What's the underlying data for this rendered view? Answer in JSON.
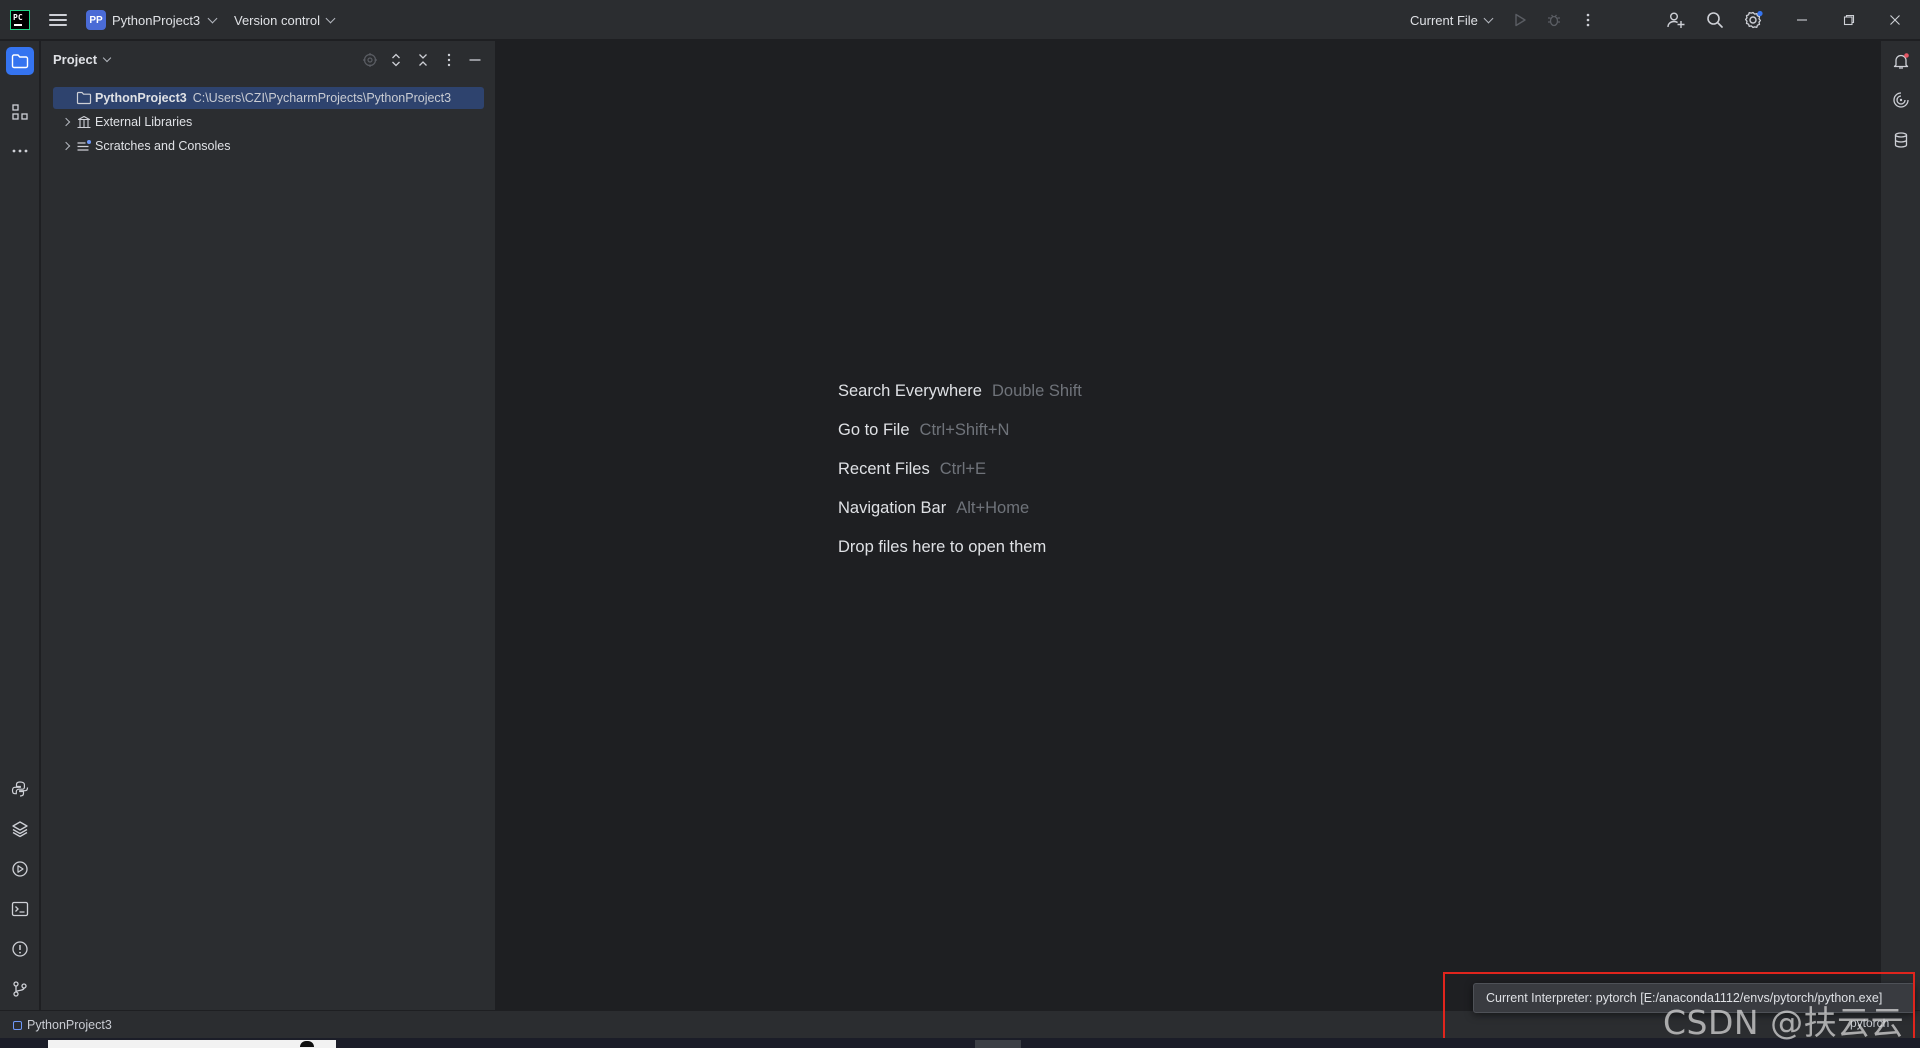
{
  "titlebar": {
    "project_badge": "PP",
    "project_name": "PythonProject3",
    "vcs_label": "Version control",
    "run_config": "Current File"
  },
  "project_panel": {
    "title": "Project",
    "tree": [
      {
        "name": "PythonProject3",
        "path": "C:\\Users\\CZI\\PycharmProjects\\PythonProject3",
        "selected": true
      },
      {
        "name": "External Libraries"
      },
      {
        "name": "Scratches and Consoles"
      }
    ]
  },
  "editor": {
    "hints": [
      {
        "action": "Search Everywhere",
        "shortcut": "Double Shift"
      },
      {
        "action": "Go to File",
        "shortcut": "Ctrl+Shift+N"
      },
      {
        "action": "Recent Files",
        "shortcut": "Ctrl+E"
      },
      {
        "action": "Navigation Bar",
        "shortcut": "Alt+Home"
      },
      {
        "action": "Drop files here to open them",
        "shortcut": ""
      }
    ]
  },
  "statusbar": {
    "breadcrumb": "PythonProject3",
    "interpreter_widget": "pytorch"
  },
  "tooltip": {
    "text": "Current Interpreter: pytorch [E:/anaconda1112/envs/pytorch/python.exe]"
  },
  "watermark": "CSDN @扶云云",
  "colors": {
    "accent": "#3574f0",
    "selection": "#2e436e",
    "highlight_box": "#e0251d",
    "background": "#1e1f22",
    "panel": "#2b2d30"
  },
  "icons": {
    "titlebar": [
      "pycharm-logo-icon",
      "main-menu-icon",
      "run-icon",
      "debug-icon",
      "more-actions-icon",
      "code-with-me-icon",
      "search-icon",
      "settings-icon",
      "minimize-icon",
      "restore-icon",
      "close-icon"
    ],
    "left_stripe": [
      "project-icon",
      "structure-icon",
      "more-tools-icon",
      "python-packages-icon",
      "layers-icon",
      "services-icon",
      "terminal-icon",
      "problems-icon",
      "git-icon"
    ],
    "right_stripe": [
      "notifications-icon",
      "ai-assistant-icon",
      "database-icon"
    ]
  }
}
